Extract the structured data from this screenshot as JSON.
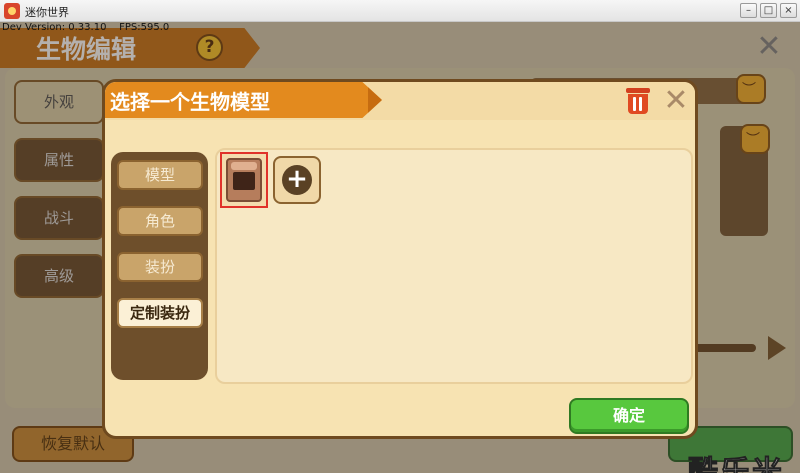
{
  "window": {
    "title": "迷你世界",
    "minimize": "–",
    "maximize": "□",
    "close": "×"
  },
  "devinfo": "Dev Version: 0.33.10    FPS:595.0",
  "background": {
    "title": "生物编辑",
    "help_label": "?",
    "close_label": "✕",
    "sidebar": [
      "外观",
      "属性",
      "战斗",
      "高级"
    ],
    "reset_label": "恢复默认"
  },
  "modal": {
    "title": "选择一个生物模型",
    "close_label": "✕",
    "tabs": [
      {
        "label": "模型",
        "active": false
      },
      {
        "label": "角色",
        "active": false
      },
      {
        "label": "装扮",
        "active": false
      },
      {
        "label": "定制装扮",
        "active": true
      }
    ],
    "add_label": "+",
    "confirm_label": "确定"
  },
  "watermark": "酷乐米",
  "colors": {
    "ribbon": "#e38a1e",
    "modal_bg": "#f7e3b2",
    "confirm": "#58c83e",
    "selection": "#e0322a"
  }
}
